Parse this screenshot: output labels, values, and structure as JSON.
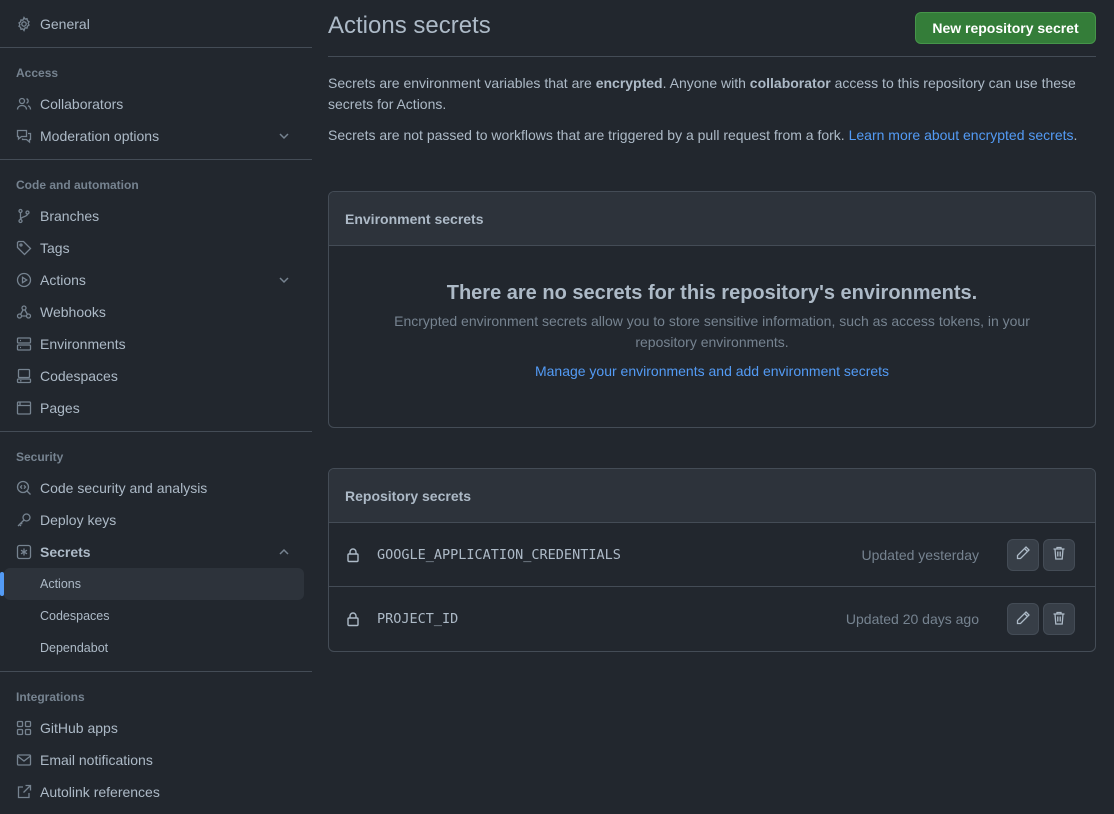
{
  "sidebar": {
    "general": "General",
    "access_heading": "Access",
    "collaborators": "Collaborators",
    "moderation": "Moderation options",
    "code_heading": "Code and automation",
    "branches": "Branches",
    "tags": "Tags",
    "actions": "Actions",
    "webhooks": "Webhooks",
    "environments": "Environments",
    "codespaces": "Codespaces",
    "pages": "Pages",
    "security_heading": "Security",
    "code_security": "Code security and analysis",
    "deploy_keys": "Deploy keys",
    "secrets": "Secrets",
    "secrets_sub": [
      "Actions",
      "Codespaces",
      "Dependabot"
    ],
    "integrations_heading": "Integrations",
    "github_apps": "GitHub apps",
    "email_notifications": "Email notifications",
    "autolink": "Autolink references"
  },
  "main": {
    "title": "Actions secrets",
    "new_button": "New repository secret",
    "p1_a": "Secrets are environment variables that are ",
    "p1_b": "encrypted",
    "p1_c": ". Anyone with ",
    "p1_d": "collaborator",
    "p1_e": " access to this repository can use these secrets for Actions.",
    "p2_a": "Secrets are not passed to workflows that are triggered by a pull request from a fork. ",
    "p2_link": "Learn more about encrypted secrets",
    "p2_end": ".",
    "env_box": {
      "heading": "Environment secrets",
      "blank_title": "There are no secrets for this repository's environments.",
      "blank_text": "Encrypted environment secrets allow you to store sensitive information, such as access tokens, in your repository environments.",
      "link": "Manage your environments and add environment secrets"
    },
    "repo_box": {
      "heading": "Repository secrets",
      "rows": [
        {
          "name": "GOOGLE_APPLICATION_CREDENTIALS",
          "updated": "Updated yesterday"
        },
        {
          "name": "PROJECT_ID",
          "updated": "Updated 20 days ago"
        }
      ]
    }
  },
  "colors": {
    "background": "#22272e",
    "accent": "#539bf5",
    "primary_button": "#347d39"
  }
}
